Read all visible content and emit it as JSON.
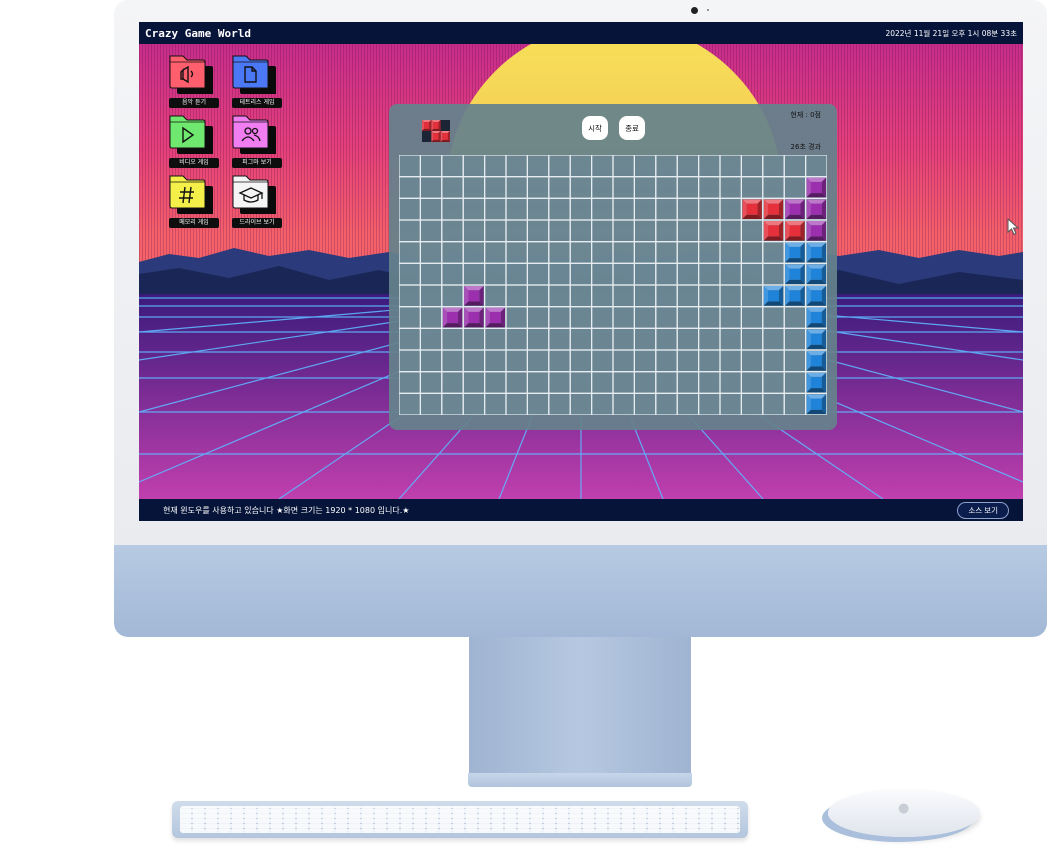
{
  "desktop": {
    "window_title": "Crazy Game World",
    "clock": "2022년 11월 21일 오후 1시 08분 33초",
    "status_text": "현재 윈도우를 사용하고 있습니다 ★화면 크기는 1920 * 1080 입니다.★",
    "source_button": "소스 보기",
    "icons": [
      {
        "label": "음악 듣기",
        "color": "#ff5e6c",
        "glyph": "music-icon"
      },
      {
        "label": "테트리스 게임",
        "color": "#4b78f5",
        "glyph": "document-icon"
      },
      {
        "label": "비디오 게임",
        "color": "#6ee86e",
        "glyph": "play-icon"
      },
      {
        "label": "피그마 보기",
        "color": "#f07ef0",
        "glyph": "users-icon"
      },
      {
        "label": "메모리 게임",
        "color": "#f5ef4a",
        "glyph": "hashtag-icon"
      },
      {
        "label": "드라이브 보기",
        "color": "#f5f5f5",
        "glyph": "graduation-cap-icon"
      }
    ]
  },
  "game": {
    "start_label": "시작",
    "stop_label": "종료",
    "score_text": "현재 : 0점",
    "timer_text": "26초 경과",
    "cols": 20,
    "rows": 12,
    "colors": {
      "purple": "#9b2fae",
      "red": "#e5303b",
      "blue": "#1e83d9",
      "next_bg": "#1b2536"
    },
    "blocks": [
      {
        "c": 3,
        "r": 6,
        "k": "purple"
      },
      {
        "c": 2,
        "r": 7,
        "k": "purple"
      },
      {
        "c": 3,
        "r": 7,
        "k": "purple"
      },
      {
        "c": 4,
        "r": 7,
        "k": "purple"
      },
      {
        "c": 19,
        "r": 1,
        "k": "purple"
      },
      {
        "c": 16,
        "r": 2,
        "k": "red"
      },
      {
        "c": 17,
        "r": 2,
        "k": "red"
      },
      {
        "c": 18,
        "r": 2,
        "k": "purple"
      },
      {
        "c": 19,
        "r": 2,
        "k": "purple"
      },
      {
        "c": 17,
        "r": 3,
        "k": "red"
      },
      {
        "c": 18,
        "r": 3,
        "k": "red"
      },
      {
        "c": 19,
        "r": 3,
        "k": "purple"
      },
      {
        "c": 18,
        "r": 4,
        "k": "blue"
      },
      {
        "c": 19,
        "r": 4,
        "k": "blue"
      },
      {
        "c": 18,
        "r": 5,
        "k": "blue"
      },
      {
        "c": 19,
        "r": 5,
        "k": "blue"
      },
      {
        "c": 17,
        "r": 6,
        "k": "blue"
      },
      {
        "c": 18,
        "r": 6,
        "k": "blue"
      },
      {
        "c": 19,
        "r": 6,
        "k": "blue"
      },
      {
        "c": 19,
        "r": 7,
        "k": "blue"
      },
      {
        "c": 19,
        "r": 8,
        "k": "blue"
      },
      {
        "c": 19,
        "r": 9,
        "k": "blue"
      },
      {
        "c": 19,
        "r": 10,
        "k": "blue"
      },
      {
        "c": 19,
        "r": 11,
        "k": "blue"
      }
    ],
    "next_piece": [
      {
        "c": 0,
        "r": 0,
        "k": "red"
      },
      {
        "c": 1,
        "r": 0,
        "k": "red"
      },
      {
        "c": 1,
        "r": 1,
        "k": "red"
      },
      {
        "c": 2,
        "r": 1,
        "k": "red"
      }
    ]
  }
}
